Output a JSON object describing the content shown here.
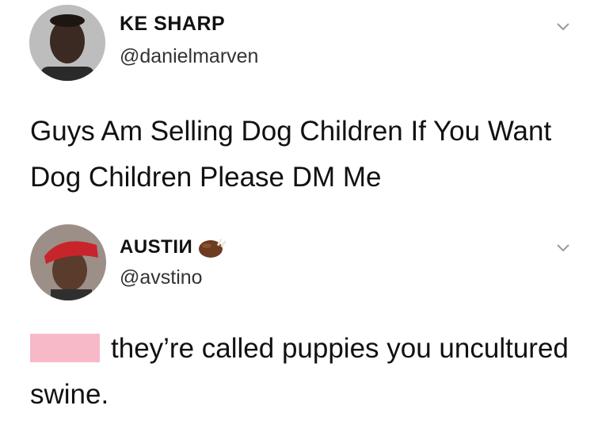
{
  "tweets": [
    {
      "display_name": "KE SHARP",
      "handle": "@danielmarven",
      "text": "Guys Am Selling Dog Children If You Want Dog Children Please DM Me"
    },
    {
      "display_name": "AUSTIИ",
      "name_emoji": "roasted-turkey-emoji",
      "handle": "@avstino",
      "text": "they’re called puppies you uncultured swine.",
      "redaction_color": "#f7b8c8"
    }
  ],
  "icons": {
    "menu": "chevron-down-icon"
  }
}
